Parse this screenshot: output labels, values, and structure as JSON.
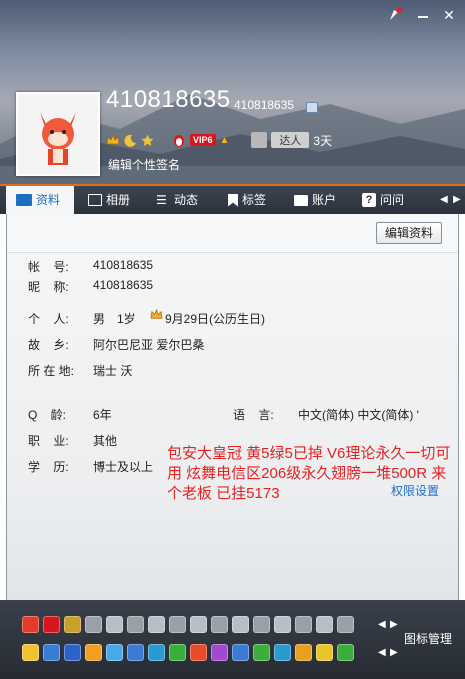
{
  "header": {
    "qq_number_large": "410818635",
    "qq_number_small": "410818635",
    "vip_label": "VIP6",
    "talent_label": "达人",
    "active_days": "3天",
    "signature_placeholder": "编辑个性签名",
    "close_label": "✕"
  },
  "tabs": [
    {
      "label": "资料",
      "icon": "profile-card-icon"
    },
    {
      "label": "相册",
      "icon": "album-icon"
    },
    {
      "label": "动态",
      "icon": "feed-icon"
    },
    {
      "label": "标签",
      "icon": "bookmark-icon"
    },
    {
      "label": "账户",
      "icon": "wallet-icon"
    },
    {
      "label": "问问",
      "icon": "question-icon"
    }
  ],
  "content": {
    "edit_button": "编辑资料",
    "fields": {
      "account_label": "帐    号:",
      "account_value": "410818635",
      "nickname_label": "昵    称:",
      "nickname_value": "410818635",
      "personal_label": "个    人:",
      "gender": "男",
      "age": "1岁",
      "birthday": "9月29日(公历生日)",
      "hometown_label": "故    乡:",
      "hometown_value": "阿尔巴尼亚 爱尔巴桑",
      "location_label": "所 在 地:",
      "location_value": "瑞士 沃",
      "qage_label": "Q    龄:",
      "qage_value": "6年",
      "language_label": "语    言:",
      "language_value": "中文(简体) 中文(简体) '",
      "job_label": "职    业:",
      "job_value": "其他",
      "edu_label": "学    历:",
      "edu_value": "博士及以上"
    },
    "promo_text": "包安大皇冠 黄5绿5已掉 V6理论永久一切可用 炫舞电信区206级永久翅膀一堆500R 来个老板  已挂5173",
    "permission_link": "权限设置"
  },
  "bottom": {
    "icon_manager": "图标管理",
    "row1_colors": [
      "#e23b2a",
      "#d8161d",
      "#c8a02a",
      "#9aa0a8",
      "#b8bec6",
      "#9aa0a8",
      "#b8bec6",
      "#9aa0a8",
      "#b8bec6",
      "#9aa0a8",
      "#b8bec6",
      "#9aa0a8",
      "#b8bec6",
      "#9aa0a8",
      "#b8bec6",
      "#9aa0a8"
    ],
    "row2_colors": [
      "#f2c12e",
      "#3a7bd5",
      "#2a64c8",
      "#f0a020",
      "#4aa8e8",
      "#3a7bd5",
      "#2a9ad0",
      "#3cae3c",
      "#e84a2a",
      "#a04ad0",
      "#3a7bd5",
      "#3cae3c",
      "#2a9ad0",
      "#e8a020",
      "#e8c62a",
      "#3cae3c"
    ]
  },
  "colors": {
    "accent_orange": "#e06e1f",
    "promo_red": "#e32222",
    "link_blue": "#1f6fd1",
    "tab_active_text": "#1d6fc2"
  }
}
